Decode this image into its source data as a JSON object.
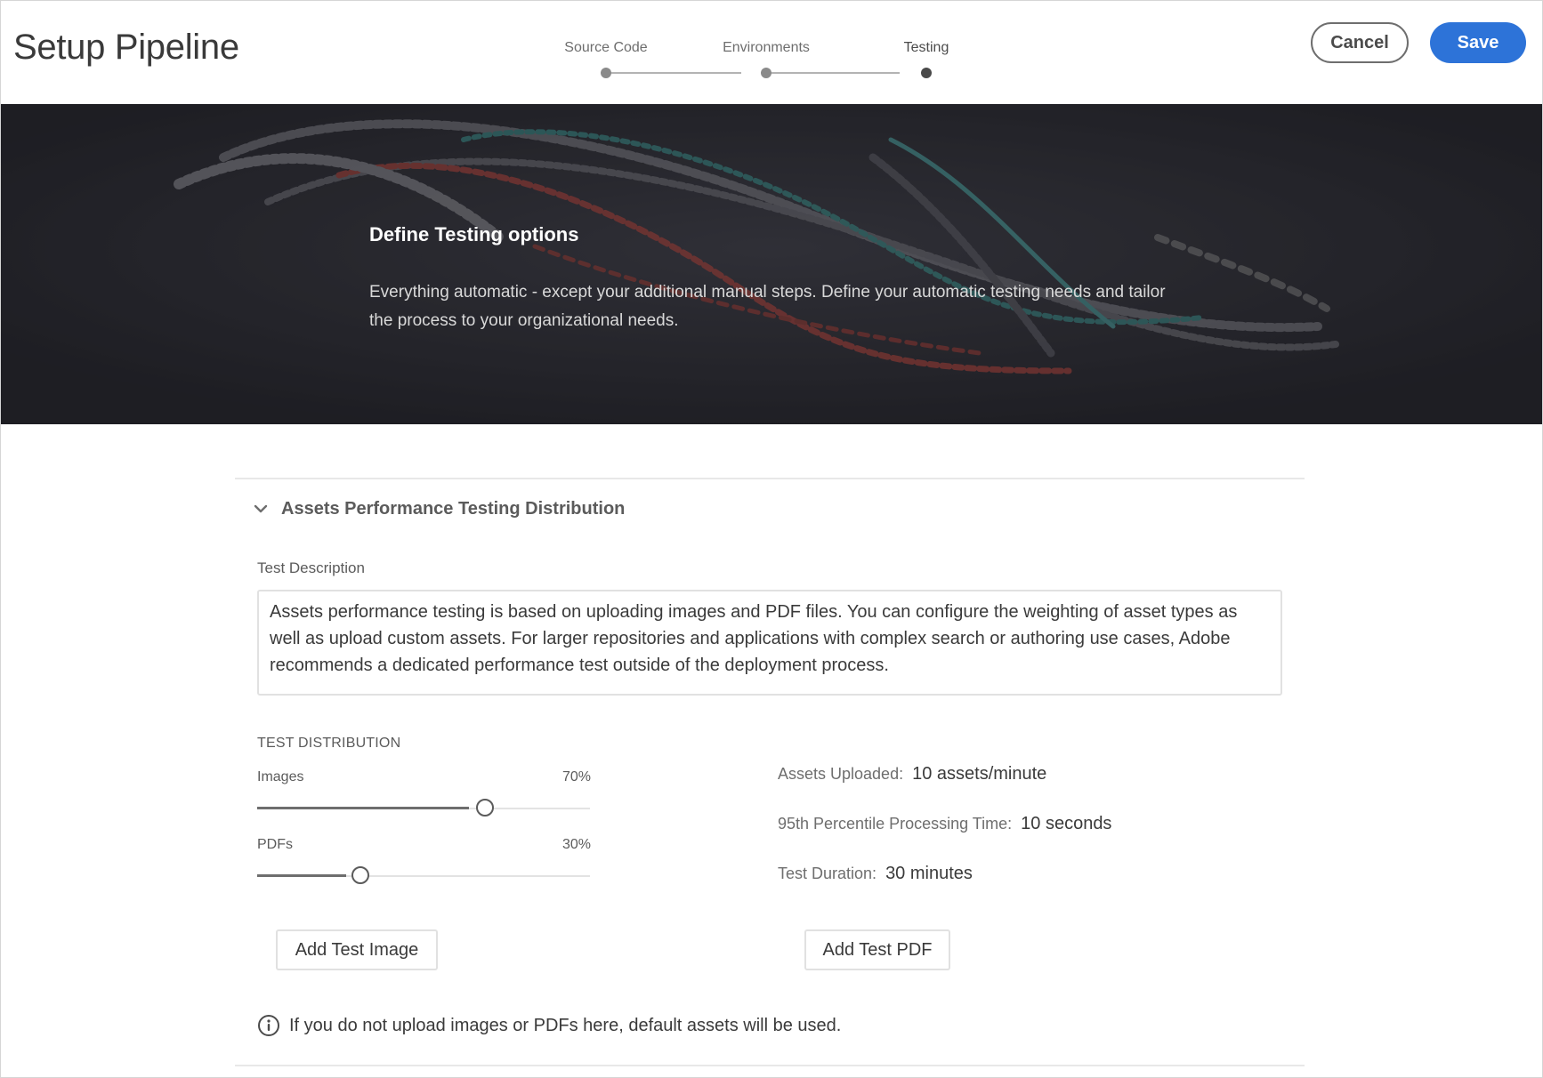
{
  "header": {
    "title": "Setup Pipeline",
    "steps": [
      {
        "label": "Source Code",
        "active": false
      },
      {
        "label": "Environments",
        "active": false
      },
      {
        "label": "Testing",
        "active": true
      }
    ],
    "cancel_label": "Cancel",
    "save_label": "Save",
    "save_color": "#2d73d8"
  },
  "hero": {
    "title": "Define Testing options",
    "body": "Everything automatic - except your additional manual steps. Define your automatic testing needs and tailor the process to your organizational needs."
  },
  "section": {
    "title": "Assets Performance Testing Distribution",
    "expanded": true,
    "description_label": "Test Description",
    "description": "Assets performance testing is based on uploading images and PDF files. You can configure the weighting of asset types as well as upload custom assets. For larger repositories and applications with complex search or authoring use cases, Adobe recommends a dedicated performance test outside of the deployment process.",
    "distribution_heading": "TEST DISTRIBUTION",
    "sliders": [
      {
        "label": "Images",
        "value_text": "70%",
        "value": 0.7
      },
      {
        "label": "PDFs",
        "value_text": "30%",
        "value": 0.3
      }
    ],
    "stats": [
      {
        "label": "Assets Uploaded:",
        "value": "10 assets/minute"
      },
      {
        "label": "95th Percentile Processing Time:",
        "value": "10 seconds"
      },
      {
        "label": "Test Duration:",
        "value": "30 minutes"
      }
    ],
    "add_image_label": "Add Test Image",
    "add_pdf_label": "Add Test PDF",
    "info_text": "If you do not upload images or PDFs here, default assets will be used."
  }
}
